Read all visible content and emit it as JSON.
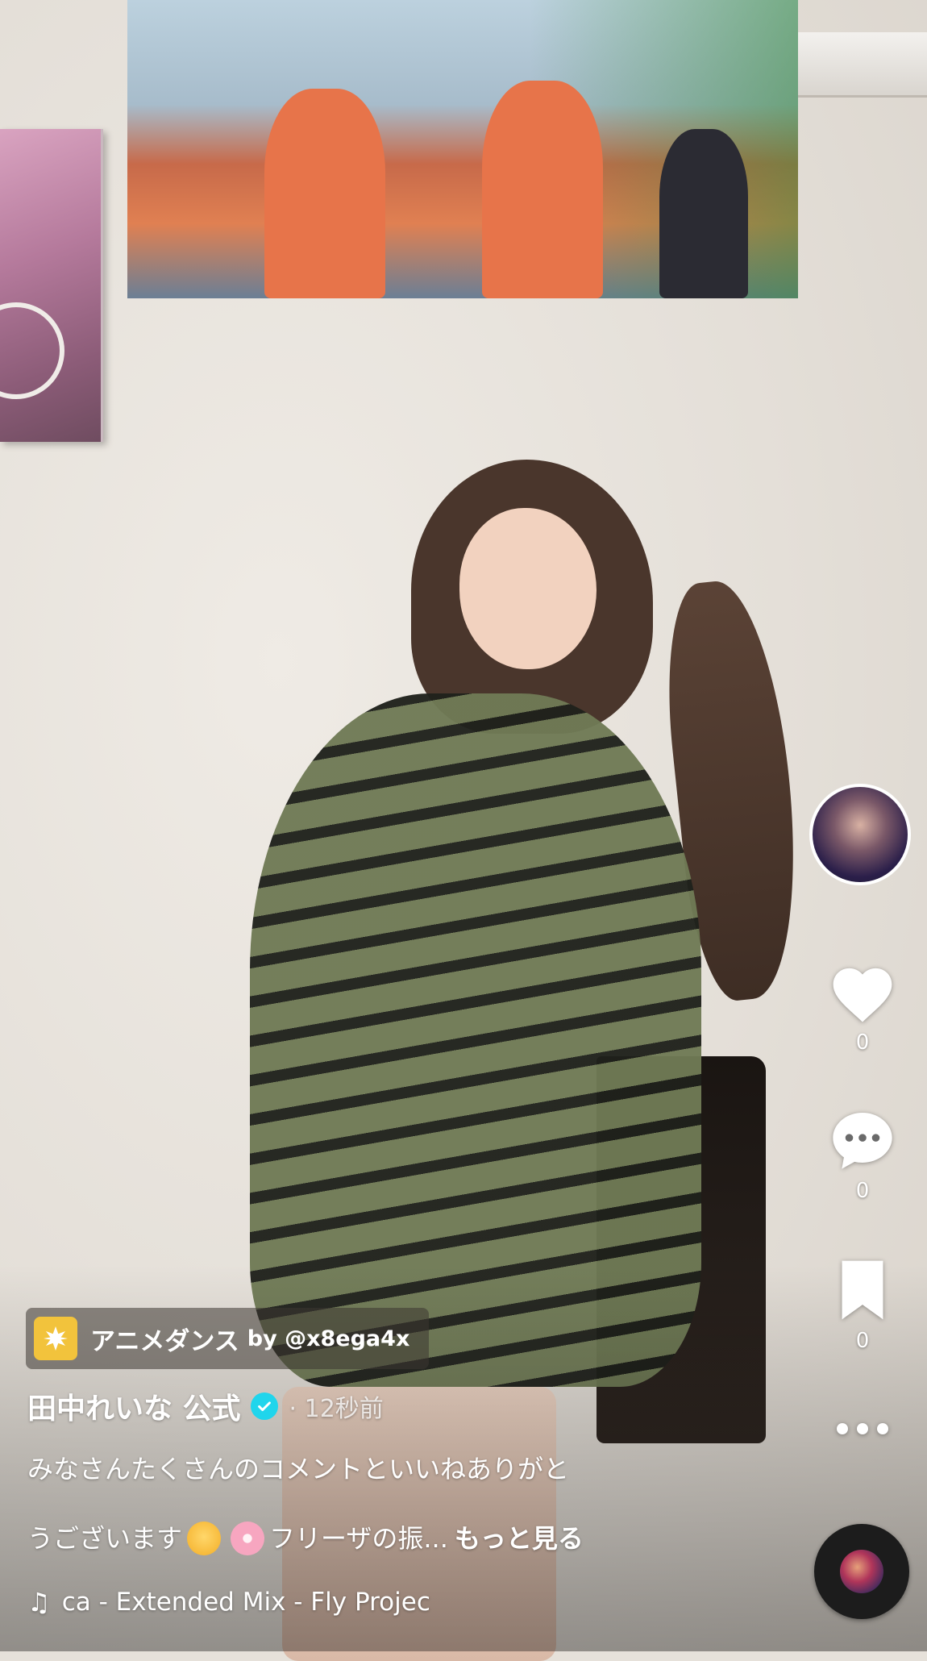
{
  "video": {
    "description_visual": "dance video background"
  },
  "rail": {
    "like_count": "0",
    "comment_count": "0",
    "save_count": "0"
  },
  "effect": {
    "name": "アニメダンス",
    "by": "by @x8ega4x"
  },
  "author": {
    "name": "田中れいな 公式",
    "timestamp": "· 12秒前"
  },
  "caption": {
    "line1": "みなさんたくさんのコメントといいねありがと",
    "line2_before": "うございます",
    "line2_after": "フリーザの振...",
    "see_more": "もっと見る"
  },
  "music": {
    "title": "ca - Extended Mix - Fly Projec"
  },
  "colors": {
    "verified": "#20d5ec",
    "effect_icon": "#f2c33c"
  },
  "icons": [
    "heart-icon",
    "comment-icon",
    "bookmark-icon",
    "more-icon",
    "music-note-icon",
    "verified-icon",
    "sparkle-icon"
  ]
}
